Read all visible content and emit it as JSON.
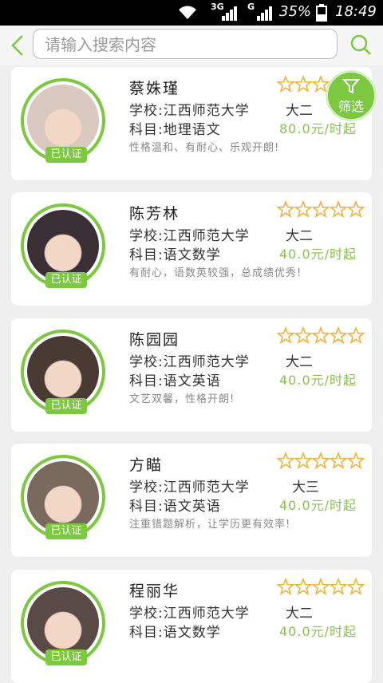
{
  "status": {
    "network": "3G",
    "network2": "G",
    "battery": "35%",
    "time": "18:49"
  },
  "search": {
    "placeholder": "请输入搜索内容"
  },
  "filter_label": "筛选",
  "teachers": [
    {
      "name": "蔡姝瑾",
      "school": "学校:江西师范大学",
      "grade": "大二",
      "subject": "科目:地理语文",
      "price": "80.0元/时起",
      "desc": "性格温和、有耐心、乐观开朗!",
      "badge": "已认证",
      "rating": 0
    },
    {
      "name": "陈芳林",
      "school": "学校:江西师范大学",
      "grade": "大二",
      "subject": "科目:语文数学",
      "price": "40.0元/时起",
      "desc": "有耐心，语数英较强，总成绩优秀!",
      "badge": "已认证",
      "rating": 0
    },
    {
      "name": "陈园园",
      "school": "学校:江西师范大学",
      "grade": "大二",
      "subject": "科目:语文英语",
      "price": "40.0元/时起",
      "desc": "文艺双馨，性格开朗!",
      "badge": "已认证",
      "rating": 0
    },
    {
      "name": "方瞄",
      "school": "学校:江西师范大学",
      "grade": "大三",
      "subject": "科目:语文英语",
      "price": "40.0元/时起",
      "desc": "注重错题解析，让学历更有效率!",
      "badge": "已认证",
      "rating": 0
    },
    {
      "name": "程丽华",
      "school": "学校:江西师范大学",
      "grade": "大二",
      "subject": "科目:语文数学",
      "price": "40.0元/时起",
      "desc": "",
      "badge": "已认证",
      "rating": 0
    }
  ],
  "colors": {
    "accent": "#7cc840",
    "star": "#f0b33a",
    "price": "#8cc051"
  }
}
